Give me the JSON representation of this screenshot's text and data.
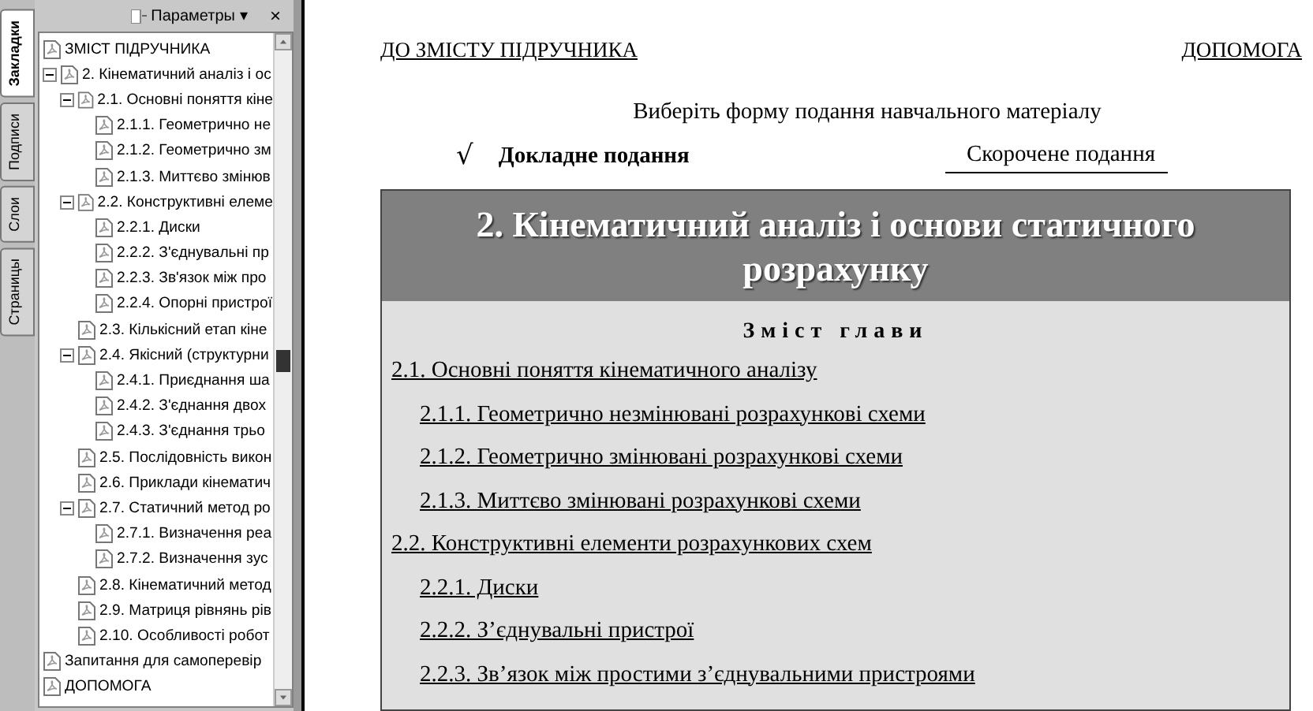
{
  "panel": {
    "tabs": [
      {
        "label": "Закладки",
        "selected": true
      },
      {
        "label": "Подписи",
        "selected": false
      },
      {
        "label": "Слои",
        "selected": false
      },
      {
        "label": "Страницы",
        "selected": false
      }
    ],
    "options_label": "Параметры",
    "options_caret": "▾",
    "close": "×",
    "tree": [
      {
        "label": "ЗМІСТ ПІДРУЧНИКА"
      },
      {
        "label": "2. Кінематичний аналіз і ос",
        "expanded": true,
        "children": [
          {
            "label": "2.1. Основні поняття кіне",
            "expanded": true,
            "children": [
              {
                "label": "2.1.1. Геометрично не"
              },
              {
                "label": "2.1.2. Геометрично зм"
              },
              {
                "label": "2.1.3. Миттєво змінюв"
              }
            ]
          },
          {
            "label": "2.2. Конструктивні елеме",
            "expanded": true,
            "children": [
              {
                "label": "2.2.1. Диски"
              },
              {
                "label": "2.2.2. З'єднувальні пр"
              },
              {
                "label": "2.2.3. Зв'язок між про"
              },
              {
                "label": "2.2.4. Опорні пристрої"
              }
            ]
          },
          {
            "label": "2.3. Кількісний етап кіне"
          },
          {
            "label": "2.4. Якісний (структурни",
            "expanded": true,
            "children": [
              {
                "label": "2.4.1. Приєднання ша"
              },
              {
                "label": "2.4.2. З'єднання двох"
              },
              {
                "label": "2.4.3. З'єднання трьо"
              }
            ]
          },
          {
            "label": "2.5. Послідовність викон"
          },
          {
            "label": "2.6. Приклади кінематич"
          },
          {
            "label": "2.7. Статичний метод ро",
            "expanded": true,
            "children": [
              {
                "label": "2.7.1. Визначення реа"
              },
              {
                "label": "2.7.2. Визначення зус"
              }
            ]
          },
          {
            "label": "2.8. Кінематичний метод"
          },
          {
            "label": "2.9. Матриця рівнянь рів"
          },
          {
            "label": "2.10. Особливості робот"
          }
        ]
      },
      {
        "label": "Запитання для самоперевір"
      },
      {
        "label": "ДОПОМОГА"
      }
    ]
  },
  "document": {
    "links": [
      "ДО ЗМІСТУ ПІДРУЧНИКА",
      "ДОПОМОГА"
    ],
    "prompt": "Виберіть форму подання навчального матеріалу",
    "check_mark": "√",
    "modes": [
      {
        "label": "Докладне подання",
        "selected": true
      },
      {
        "label": "Скорочене подання",
        "selected": false
      }
    ],
    "chapter_title": "2. Кінематичний аналіз і основи статичного розрахунку",
    "contents_heading": "Зміст глави",
    "contents": [
      {
        "label": "2.1. Основні поняття кінематичного аналізу",
        "children": [
          {
            "label": "2.1.1. Геометрично незмінювані розрахункові схеми"
          },
          {
            "label": "2.1.2. Геометрично змінювані розрахункові схеми"
          },
          {
            "label": "2.1.3. Миттєво змінювані розрахункові схеми"
          }
        ]
      },
      {
        "label": "2.2. Конструктивні елементи розрахункових схем",
        "children": [
          {
            "label": "2.2.1. Диски"
          },
          {
            "label": "2.2.2. З’єднувальні пристрої"
          },
          {
            "label": "2.2.3. Зв’язок між простими з’єднувальними пристроями"
          }
        ]
      }
    ]
  }
}
